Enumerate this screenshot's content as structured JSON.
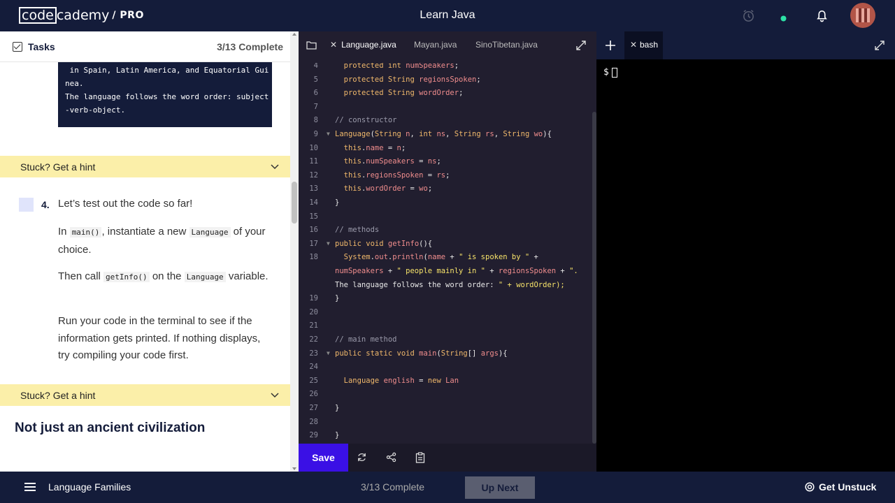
{
  "header": {
    "logo_box": "code",
    "logo_rest": "cademy",
    "logo_pro": "/ PRO",
    "course_title": "Learn Java"
  },
  "tasks": {
    "label": "Tasks",
    "count": "3/13 Complete"
  },
  "instructions": {
    "code_lines": [
      " in Spain, Latin America, and Equatorial Gui",
      "nea.",
      "The language follows the word order: subject",
      "-verb-object."
    ],
    "hint_label": "Stuck? Get a hint",
    "step_number": "4.",
    "step_title": "Let’s test out the code so far!",
    "p1_a": "In ",
    "p1_code1": "main()",
    "p1_b": ", instantiate a new ",
    "p1_code2": "Language",
    "p1_c": " of your choice.",
    "p2_a": "Then call ",
    "p2_code1": "getInfo()",
    "p2_b": " on the ",
    "p2_code2": "Language",
    "p2_c": " variable.",
    "p3": "Run your code in the terminal to see if the information gets printed. If nothing displays, try compiling your code first.",
    "hint_label_2": "Stuck? Get a hint",
    "section_title": "Not just an ancient civilization"
  },
  "editor": {
    "tabs": [
      "Language.java",
      "Mayan.java",
      "SinoTibetan.java"
    ],
    "active_tab": "Language.java",
    "save_label": "Save"
  },
  "code_lines": [
    {
      "n": "4",
      "t": "  protected int numSpeakers;"
    },
    {
      "n": "5",
      "t": "  protected String regionsSpoken;"
    },
    {
      "n": "6",
      "t": "  protected String wordOrder;"
    },
    {
      "n": "7",
      "t": ""
    },
    {
      "n": "8",
      "t": "// constructor"
    },
    {
      "n": "9",
      "t": "Language(String n, int ns, String rs, String wo){"
    },
    {
      "n": "10",
      "t": "  this.name = n;"
    },
    {
      "n": "11",
      "t": "  this.numSpeakers = ns;"
    },
    {
      "n": "12",
      "t": "  this.regionsSpoken = rs;"
    },
    {
      "n": "13",
      "t": "  this.wordOrder = wo;"
    },
    {
      "n": "14",
      "t": "}"
    },
    {
      "n": "15",
      "t": ""
    },
    {
      "n": "16",
      "t": "// methods"
    },
    {
      "n": "17",
      "t": "public void getInfo(){"
    },
    {
      "n": "18",
      "t": "  System.out.println(name + \" is spoken by \" +"
    },
    {
      "n": "",
      "t": "numSpeakers + \" people mainly in \" + regionsSpoken + \"."
    },
    {
      "n": "",
      "t": "The language follows the word order: \" + wordOrder);"
    },
    {
      "n": "19",
      "t": "}"
    },
    {
      "n": "20",
      "t": ""
    },
    {
      "n": "21",
      "t": ""
    },
    {
      "n": "22",
      "t": "// main method"
    },
    {
      "n": "23",
      "t": "public static void main(String[] args){"
    },
    {
      "n": "24",
      "t": ""
    },
    {
      "n": "25",
      "t": "  Language english = new Lan"
    },
    {
      "n": "26",
      "t": ""
    },
    {
      "n": "27",
      "t": "}"
    },
    {
      "n": "28",
      "t": ""
    },
    {
      "n": "29",
      "t": "}"
    }
  ],
  "terminal": {
    "tab_label": "bash",
    "prompt": "$"
  },
  "footer": {
    "title": "Language Families",
    "count": "3/13 Complete",
    "up_next": "Up Next",
    "get_unstuck": "Get Unstuck"
  },
  "icons": [
    "alarm-icon",
    "status-dot-icon",
    "bell-icon",
    "folder-icon",
    "expand-icon",
    "plus-icon",
    "refresh-icon",
    "share-icon",
    "clipboard-icon",
    "menu-icon",
    "lifebuoy-icon",
    "chevron-down-icon"
  ]
}
